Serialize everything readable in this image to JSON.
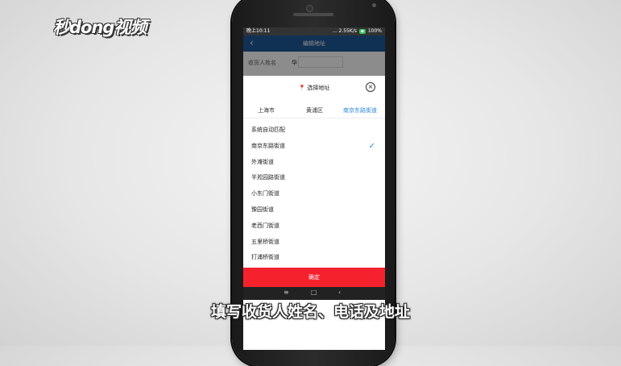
{
  "logo": {
    "text": "秒dong视频"
  },
  "status_bar": {
    "time": "晚上10:11",
    "network": "... 2.55K/s",
    "battery": "100%"
  },
  "app_bar": {
    "back": "‹",
    "title": "编辑地址"
  },
  "form": {
    "receiver_label": "收货人姓名",
    "receiver_value": "华"
  },
  "sheet": {
    "title": "选择地址",
    "pin_icon": "📍",
    "close": "×",
    "tabs": [
      {
        "label": "上海市",
        "active": false
      },
      {
        "label": "黄浦区",
        "active": false
      },
      {
        "label": "南京东路街道",
        "active": true
      }
    ],
    "items": [
      {
        "label": "系统自动匹配",
        "selected": false
      },
      {
        "label": "南京东路街道",
        "selected": true
      },
      {
        "label": "外滩街道",
        "selected": false
      },
      {
        "label": "半淞园路街道",
        "selected": false
      },
      {
        "label": "小东门街道",
        "selected": false
      },
      {
        "label": "豫园街道",
        "selected": false
      },
      {
        "label": "老西门街道",
        "selected": false
      },
      {
        "label": "五里桥街道",
        "selected": false
      },
      {
        "label": "打浦桥街道",
        "selected": false
      }
    ],
    "check": "✓",
    "confirm": "确定"
  },
  "nav": {
    "menu": "≡",
    "home": "□",
    "back": "‹"
  },
  "caption": "填写收货人姓名、电话及地址",
  "colors": {
    "accent": "#2a86d6",
    "confirm": "#f5222d",
    "appbar": "#1f5a9a"
  }
}
